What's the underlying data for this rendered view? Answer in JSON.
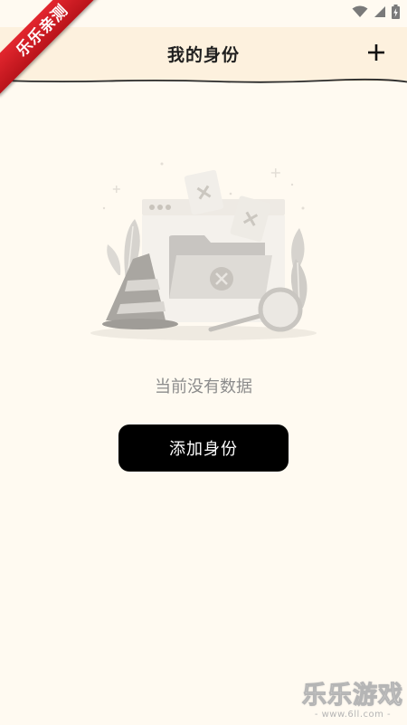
{
  "watermark_badge": {
    "text": "乐乐亲测"
  },
  "header": {
    "title": "我的身份",
    "add_icon": "plus-icon"
  },
  "empty_state": {
    "message": "当前没有数据",
    "illustration_icon": "empty-folder-illustration"
  },
  "actions": {
    "add_identity_label": "添加身份"
  },
  "footer_watermark": {
    "title": "乐乐游戏",
    "url": "- www.6ll.com -"
  },
  "status_bar": {
    "icons": [
      "wifi-icon",
      "signal-icon",
      "battery-charging-icon"
    ]
  },
  "colors": {
    "background": "#fffaf1",
    "header_background": "#fdf1de",
    "button": "#000000",
    "button_text": "#ffffff",
    "ribbon": "#d71f27"
  }
}
